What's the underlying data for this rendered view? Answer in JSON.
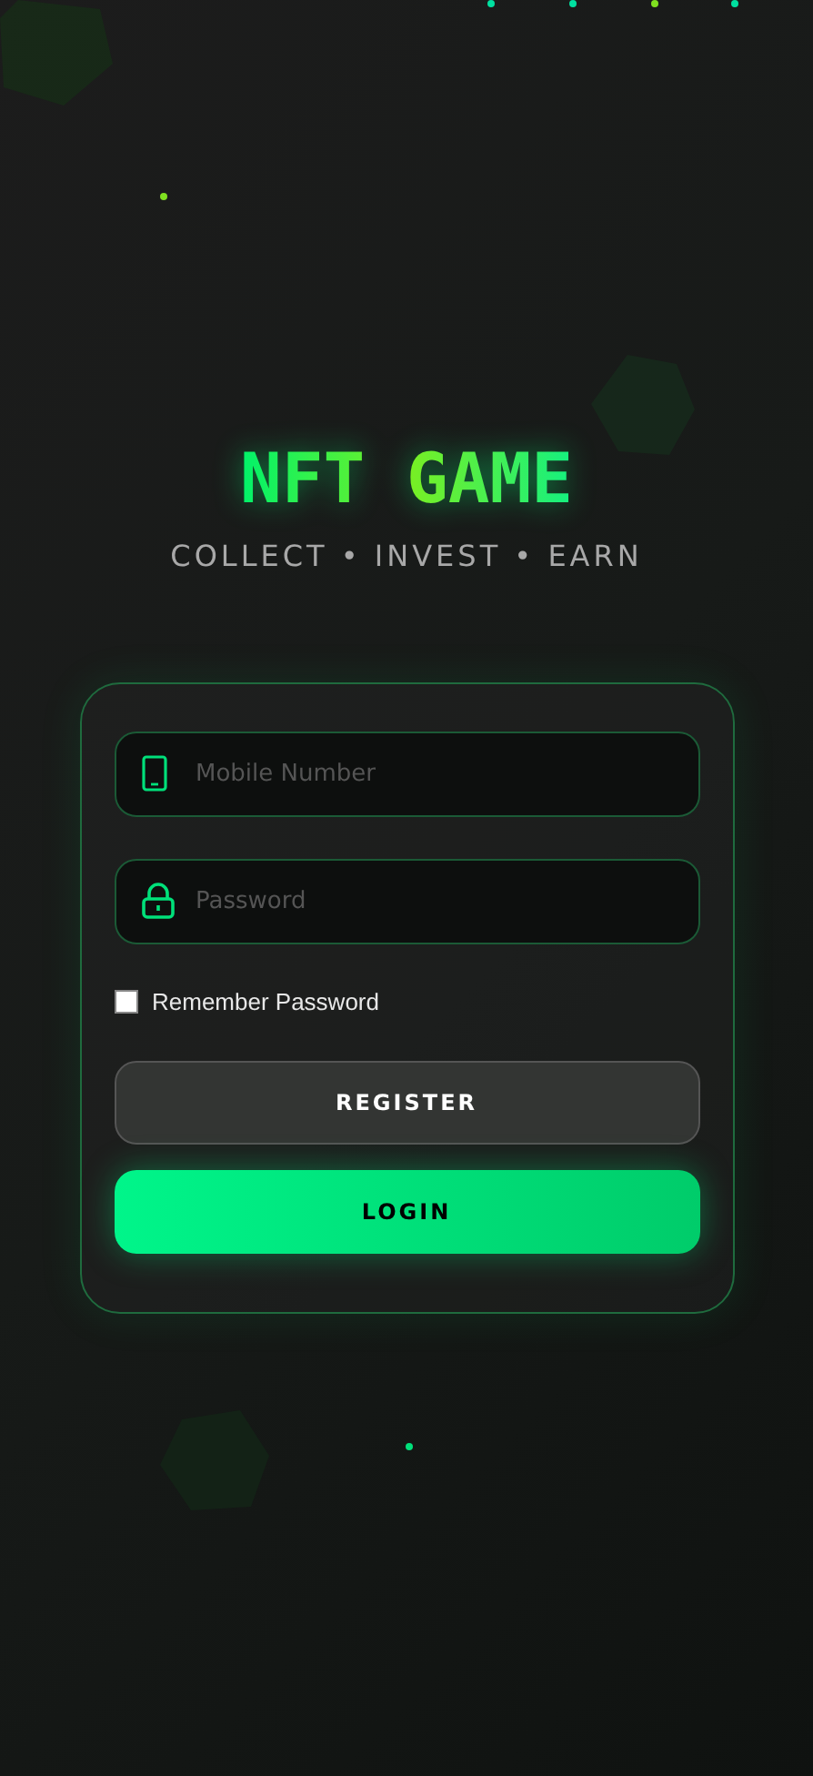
{
  "header": {
    "title": "NFT GAME",
    "tagline": "COLLECT • INVEST • EARN"
  },
  "form": {
    "fields": [
      {
        "kind": "phone",
        "placeholder": "Mobile Number"
      },
      {
        "kind": "password",
        "placeholder": "Password"
      }
    ],
    "remember": {
      "label": "Remember Password",
      "checked": false
    },
    "buttons": [
      {
        "kind": "secondary",
        "label": "REGISTER"
      },
      {
        "kind": "primary",
        "label": "LOGIN"
      }
    ]
  }
}
